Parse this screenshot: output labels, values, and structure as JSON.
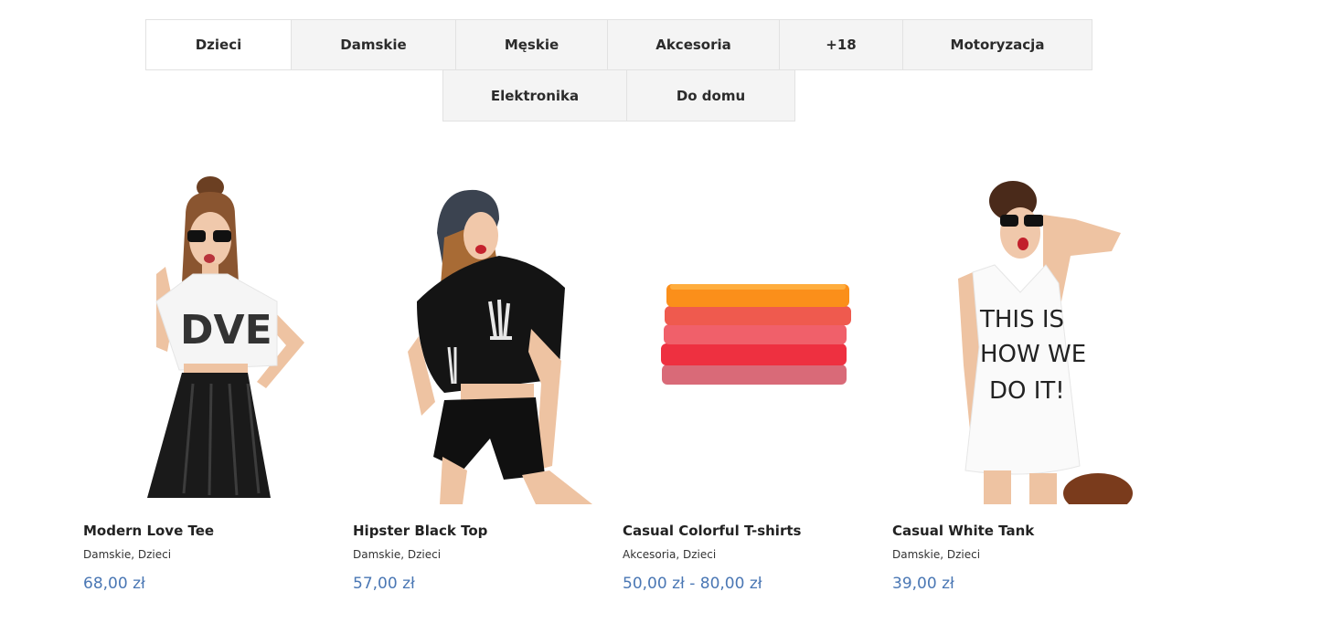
{
  "tabs_row1": [
    {
      "label": "Dzieci"
    },
    {
      "label": "Damskie"
    },
    {
      "label": "Męskie"
    },
    {
      "label": "Akcesoria"
    },
    {
      "label": "+18"
    },
    {
      "label": "Motoryzacja"
    }
  ],
  "tabs_row2": [
    {
      "label": "Elektronika"
    },
    {
      "label": "Do domu"
    }
  ],
  "products": [
    {
      "name": "Modern Love Tee",
      "cat1": "Damskie",
      "sep": ", ",
      "cat2": "Dzieci",
      "price": "68,00 zł",
      "tee_text": "DVE"
    },
    {
      "name": "Hipster Black Top",
      "cat1": "Damskie",
      "sep": ", ",
      "cat2": "Dzieci",
      "price": "57,00 zł"
    },
    {
      "name": "Casual Colorful T-shirts",
      "cat1": "Akcesoria",
      "sep": ", ",
      "cat2": "Dzieci",
      "price": "50,00 zł - 80,00 zł"
    },
    {
      "name": "Casual White Tank",
      "cat1": "Damskie",
      "sep": ", ",
      "cat2": "Dzieci",
      "price": "39,00 zł",
      "tank_line1": "THIS IS",
      "tank_line2": "HOW WE",
      "tank_line3": "DO IT!"
    }
  ],
  "colors": {
    "price": "#4a77b4",
    "tab_bg": "#f4f4f4",
    "tab_active_bg": "#ffffff"
  }
}
